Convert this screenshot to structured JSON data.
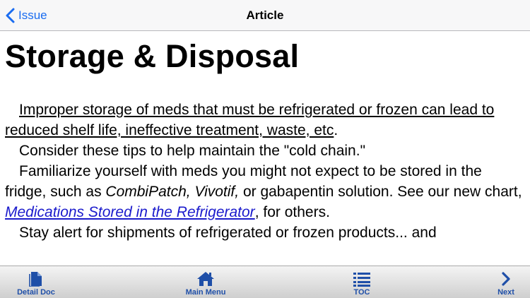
{
  "navbar": {
    "back_label": "Issue",
    "title": "Article"
  },
  "article": {
    "title": "Storage & Disposal",
    "p1": "Improper storage of meds that must be refrigerated or frozen can lead to reduced shelf life, ineffective treatment, waste, etc",
    "p1_end": ".",
    "p2": "Consider these tips to help maintain the \"cold chain.\"",
    "p3_a": "Familiarize yourself with meds you might not expect to be stored in the fridge, such as ",
    "p3_italic": "CombiPatch, Vivotif,",
    "p3_b": " or gabapentin solution. See our new chart, ",
    "p3_link": "Medications Stored in the Refrigerator",
    "p3_c": ", for others.",
    "p4": "Stay alert for shipments of refrigerated or frozen products... and"
  },
  "toolbar": {
    "detail_doc": "Detail Doc",
    "main_menu": "Main Menu",
    "toc": "TOC",
    "next": "Next"
  },
  "colors": {
    "accent": "#1a6cf0",
    "link": "#1a1acc",
    "toolbar_icon": "#1f4fa8"
  },
  "icons": {
    "back": "chevron-left-icon",
    "detail_doc": "document-icon",
    "main_menu": "home-icon",
    "toc": "list-icon",
    "next": "chevron-right-icon"
  }
}
